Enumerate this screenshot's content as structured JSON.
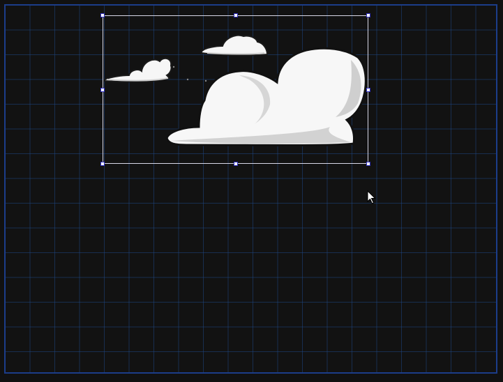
{
  "canvas": {
    "background_color": "#121212",
    "grid_color": "#1e4682",
    "border_color": "#1c3d8a"
  },
  "selection": {
    "handle_fill": "#ffffff",
    "handle_stroke": "#3030c0",
    "box_stroke": "#d8d8e8"
  },
  "graphic": {
    "icon": "clouds-image",
    "cloud_fill": "#f6f6f6",
    "cloud_shade": "#cfcfcf",
    "cloud_outline": "#1a1a1a"
  },
  "cursor": {
    "icon": "arrow-cursor"
  }
}
